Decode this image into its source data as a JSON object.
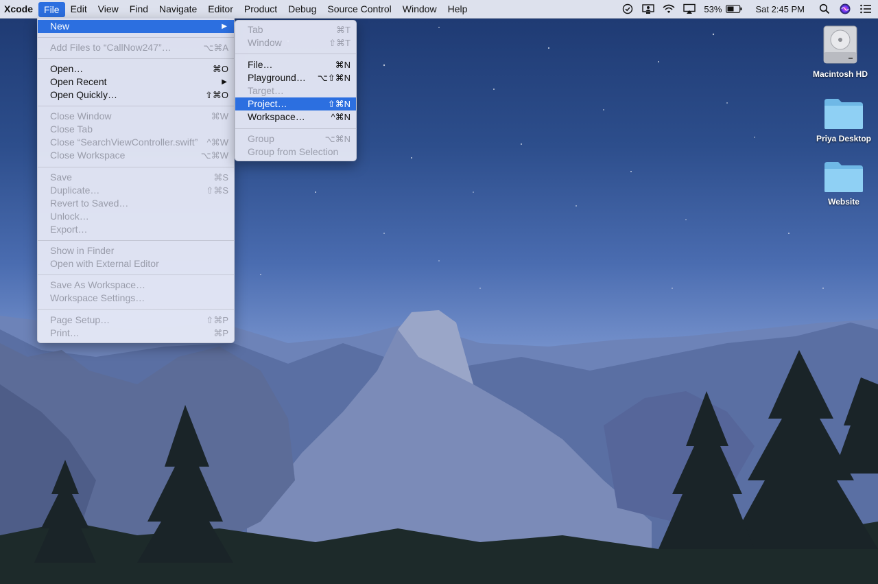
{
  "menubar": {
    "app_name": "Xcode",
    "items": [
      "File",
      "Edit",
      "View",
      "Find",
      "Navigate",
      "Editor",
      "Product",
      "Debug",
      "Source Control",
      "Window",
      "Help"
    ],
    "status": {
      "battery": "53%",
      "clock": "Sat 2:45 PM"
    }
  },
  "file_menu": {
    "new": "New",
    "add_files": "Add Files to “CallNow247”…",
    "add_files_sc": "⌥⌘A",
    "open": "Open…",
    "open_sc": "⌘O",
    "open_recent": "Open Recent",
    "open_quickly": "Open Quickly…",
    "open_quickly_sc": "⇧⌘O",
    "close_window": "Close Window",
    "close_window_sc": "⌘W",
    "close_tab": "Close Tab",
    "close_file": "Close “SearchViewController.swift”",
    "close_file_sc": "^⌘W",
    "close_workspace": "Close Workspace",
    "close_workspace_sc": "⌥⌘W",
    "save": "Save",
    "save_sc": "⌘S",
    "duplicate": "Duplicate…",
    "duplicate_sc": "⇧⌘S",
    "revert": "Revert to Saved…",
    "unlock": "Unlock…",
    "export": "Export…",
    "show_in_finder": "Show in Finder",
    "open_external": "Open with External Editor",
    "save_as_workspace": "Save As Workspace…",
    "workspace_settings": "Workspace Settings…",
    "page_setup": "Page Setup…",
    "page_setup_sc": "⇧⌘P",
    "print": "Print…",
    "print_sc": "⌘P"
  },
  "new_submenu": {
    "tab": "Tab",
    "tab_sc": "⌘T",
    "window": "Window",
    "window_sc": "⇧⌘T",
    "file": "File…",
    "file_sc": "⌘N",
    "playground": "Playground…",
    "playground_sc": "⌥⇧⌘N",
    "target": "Target…",
    "project": "Project…",
    "project_sc": "⇧⌘N",
    "workspace": "Workspace…",
    "workspace_sc": "^⌘N",
    "group": "Group",
    "group_sc": "⌥⌘N",
    "group_from_selection": "Group from Selection"
  },
  "desktop_icons": [
    {
      "label": "Macintosh HD",
      "icon": "hard-drive-icon"
    },
    {
      "label": "Priya Desktop",
      "icon": "folder-icon"
    },
    {
      "label": "Website",
      "icon": "folder-icon"
    }
  ],
  "colors": {
    "highlight": "#2c6fe0",
    "folder": "#7cc4ee"
  }
}
